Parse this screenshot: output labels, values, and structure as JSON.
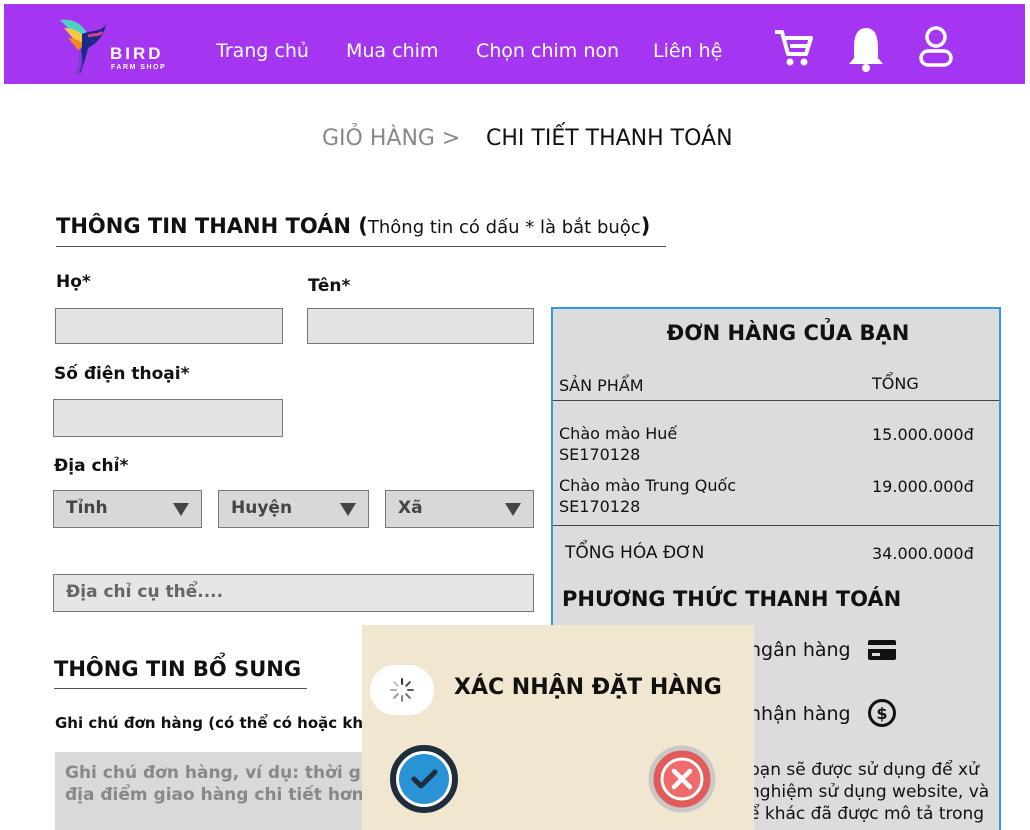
{
  "brand": {
    "name": "BIRD",
    "tagline": "FARM SHOP"
  },
  "nav": {
    "links": [
      "Trang chủ",
      "Mua chim",
      "Chọn chim non",
      "Liên hệ"
    ],
    "icons": [
      "cart-icon",
      "bell-icon",
      "user-icon"
    ]
  },
  "breadcrumb": {
    "previous": "GIỎ HÀNG >",
    "current": "CHI TIẾT THANH TOÁN"
  },
  "billing": {
    "title": "THÔNG TIN THANH TOÁN (",
    "note": "Thông tin có dấu * là bắt buộc",
    "close_paren": ")",
    "last_name_label": "Họ*",
    "first_name_label": "Tên*",
    "phone_label": "Số điện thoại*",
    "address_label": "Địa chỉ*",
    "province": "Tỉnh",
    "district": "Huyện",
    "ward": "Xã",
    "address_placeholder": "Địa chỉ cụ thể...."
  },
  "extra": {
    "title": "THÔNG TIN BỔ SUNG",
    "note_label": "Ghi chú đơn hàng (có thể có hoặc kh",
    "note_placeholder_1": "Ghi chú đơn hàng, ví dụ: thời gia",
    "note_placeholder_2": "địa điểm giao hàng chi tiết hơn"
  },
  "order": {
    "title": "ĐƠN HÀNG CỦA BẠN",
    "col_product": "SẢN PHẨM",
    "col_total": "TỔNG",
    "items": [
      {
        "name": "Chào mào Huế",
        "code": "SE170128",
        "price": "15.000.000đ"
      },
      {
        "name": "Chào mào Trung Quốc",
        "code": "SE170128",
        "price": "19.000.000đ"
      }
    ],
    "total_label": "TỔNG HÓA ĐƠN",
    "total_value": "34.000.000đ",
    "payment_title": "PHƯƠNG THỨC THANH TOÁN",
    "payment_bank": "ngân hàng",
    "payment_cod": "nhận hàng",
    "privacy_1": "bạn sẽ được sử dụng để xử",
    "privacy_2": "nghiệm sử dụng website, và",
    "privacy_3": "ể khác đã được mô tả trong"
  },
  "popup": {
    "title": "XÁC NHẬN ĐẶT HÀNG",
    "colors": {
      "confirm": "#2a93d5",
      "cancel": "#e35a5a"
    }
  }
}
